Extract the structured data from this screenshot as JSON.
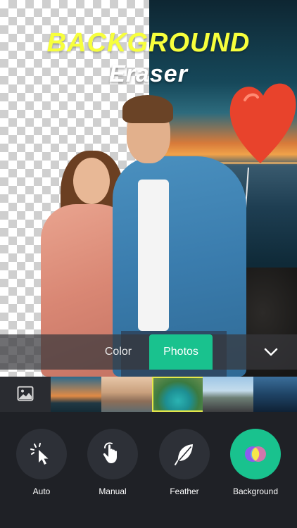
{
  "headline": {
    "line1": "BACKGROUND",
    "line2": "Eraser"
  },
  "tabs": {
    "color_label": "Color",
    "photos_label": "Photos",
    "active": "Photos"
  },
  "tools": [
    {
      "label": "Auto",
      "icon": "cursor-click-icon"
    },
    {
      "label": "Manual",
      "icon": "hand-touch-icon"
    },
    {
      "label": "Feather",
      "icon": "feather-icon"
    },
    {
      "label": "Background",
      "icon": "color-circles-icon",
      "active": true
    }
  ],
  "colors": {
    "accent": "#19c28e",
    "headline_yellow": "#f7ff3c",
    "selected_thumb_border": "#e6e84b",
    "panel_bg": "#1f2126"
  }
}
